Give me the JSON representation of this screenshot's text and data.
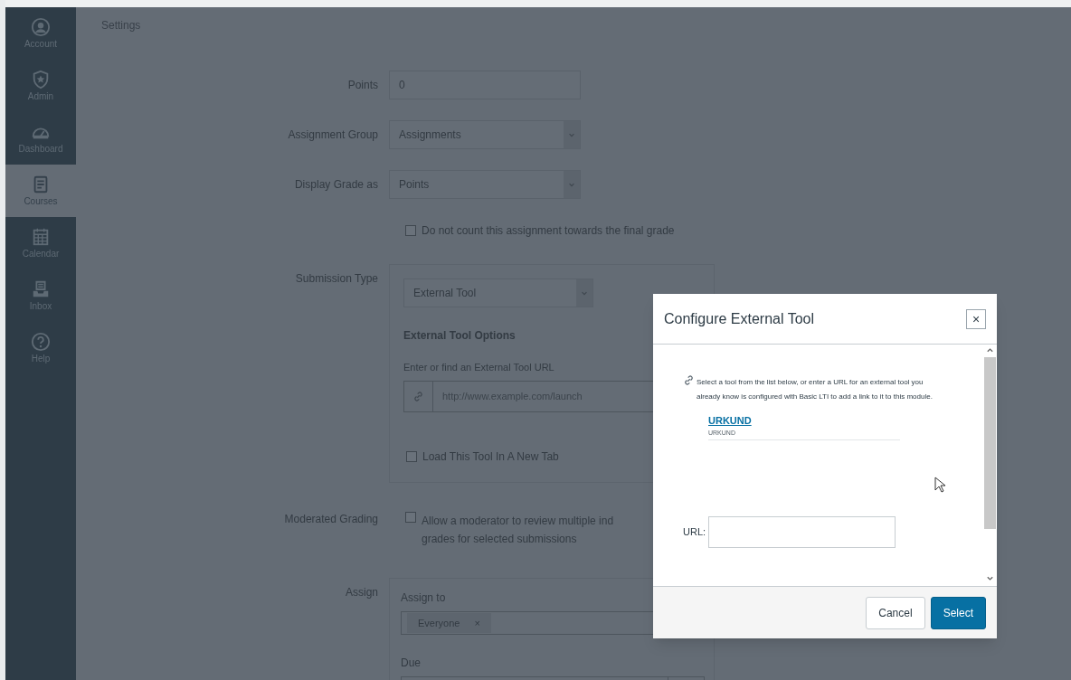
{
  "nav": [
    {
      "label": "Account",
      "selected": false
    },
    {
      "label": "Admin",
      "selected": false
    },
    {
      "label": "Dashboard",
      "selected": false
    },
    {
      "label": "Courses",
      "selected": true
    },
    {
      "label": "Calendar",
      "selected": false
    },
    {
      "label": "Inbox",
      "selected": false
    },
    {
      "label": "Help",
      "selected": false
    }
  ],
  "header": {
    "label": "Settings"
  },
  "form": {
    "points": {
      "label": "Points",
      "value": "0"
    },
    "assignment_group": {
      "label": "Assignment Group",
      "value": "Assignments"
    },
    "display_grade": {
      "label": "Display Grade as",
      "value": "Points"
    },
    "exclude": {
      "label": "Do not count this assignment towards the final grade",
      "checked": false
    },
    "submission_type": {
      "label": "Submission Type",
      "value": "External Tool",
      "options_heading": "External Tool Options",
      "url_prompt": "Enter or find an External Tool URL",
      "url_placeholder": "http://www.example.com/launch",
      "new_tab": {
        "label": "Load This Tool In A New Tab",
        "checked": false
      }
    },
    "moderated_grading": {
      "label": "Moderated Grading",
      "option_lines": [
        "Allow a moderator to review multiple ind",
        "grades for selected submissions"
      ],
      "checked": false
    },
    "assign": {
      "label": "Assign",
      "assign_to_label": "Assign to",
      "assignees": [
        {
          "label": "Everyone",
          "remove": "×"
        }
      ],
      "due_label": "Due"
    }
  },
  "dialog": {
    "title": "Configure External Tool",
    "close": "×",
    "description": "Select a tool from the list below, or enter a URL for an external tool you already know is configured with Basic LTI to add a link to it to this module.",
    "tools": [
      {
        "name": "URKUND",
        "description": "URKUND"
      }
    ],
    "url_label": "URL:",
    "buttons": [
      {
        "label": "Cancel",
        "kind": "secondary"
      },
      {
        "label": "Select",
        "kind": "primary"
      }
    ]
  }
}
